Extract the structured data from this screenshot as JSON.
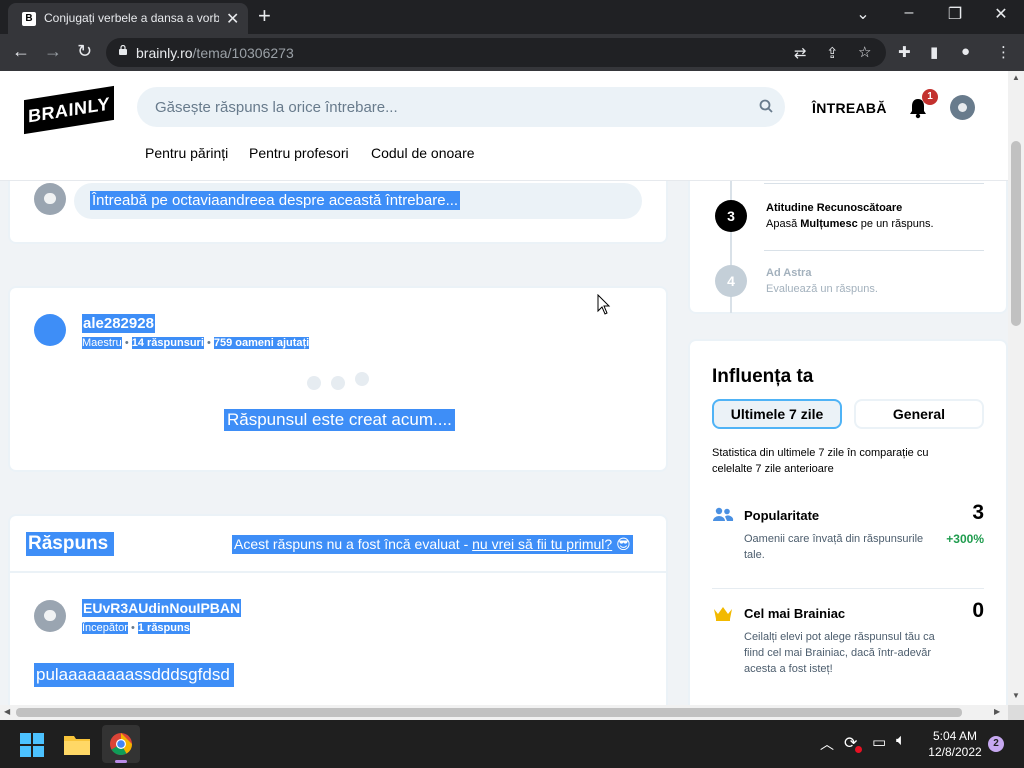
{
  "browser": {
    "tab_title": "Conjugați verbele a dansa a vorbi",
    "tab_favicon": "B",
    "url_domain": "brainly.ro",
    "url_path": "/tema/10306273"
  },
  "header": {
    "logo_text": "BRAINLY",
    "search_placeholder": "Găsește răspuns la orice întrebare...",
    "ask_label": "ÎNTREABĂ",
    "notification_count": "1",
    "subnav": [
      "Pentru părinți",
      "Pentru profesori",
      "Codul de onoare"
    ]
  },
  "ask_card": {
    "prompt": "Întreabă pe octaviaandreea despre această întrebare..."
  },
  "answering_card": {
    "username": "ale282928",
    "rank": "Maestru",
    "answers": "14 răspunsuri",
    "helped": "759 oameni ajutați",
    "status": "Răspunsul este creat acum...."
  },
  "answer_card": {
    "heading": "Răspuns",
    "not_rated": "Acest răspuns nu a fost încă evaluat - ",
    "be_first": "nu vrei să fii tu primul?",
    "emoji": "😎",
    "username": "EUvR3AUdinNouIPBAN",
    "rank": "Începător",
    "answers": "1 răspuns",
    "body": "pulaaaaaaaassdddsgfdsd"
  },
  "steps": [
    {
      "num": "3",
      "title": "Atitudine Recunoscătoare",
      "desc_pre": "Apasă ",
      "desc_bold": "Mulțumesc",
      "desc_post": " pe un răspuns."
    },
    {
      "num": "4",
      "title": "Ad Astra",
      "desc": "Evaluează un răspuns."
    }
  ],
  "influence": {
    "title": "Influența ta",
    "tab_active": "Ultimele 7 zile",
    "tab_other": "General",
    "stats_note": "Statistica din ultimele 7 zile în comparație cu celelalte 7 zile anterioare",
    "popularity": {
      "title": "Popularitate",
      "desc": "Oamenii care învață din răspunsurile tale.",
      "value": "3",
      "delta": "+300%"
    },
    "brainiac": {
      "title": "Cel mai Brainiac",
      "desc": "Ceilalți elevi pot alege răspunsul tău ca fiind cel mai Brainiac, dacă într-adevăr acesta a fost isteț!",
      "value": "0"
    }
  },
  "taskbar": {
    "time": "5:04 AM",
    "date": "12/8/2022",
    "notif_count": "2"
  },
  "colors": {
    "highlight": "#3e8ef7",
    "accent_green": "#1f9c4e",
    "badge_red": "#c3312e"
  }
}
